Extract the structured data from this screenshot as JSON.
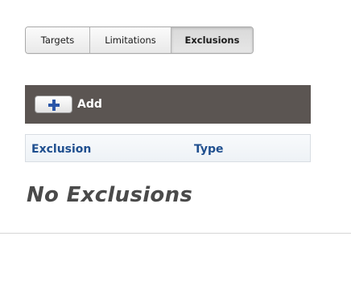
{
  "tabs": [
    {
      "label": "Targets",
      "active": false
    },
    {
      "label": "Limitations",
      "active": false
    },
    {
      "label": "Exclusions",
      "active": true
    }
  ],
  "toolbar": {
    "add_label": "Add",
    "add_icon": "plus-icon",
    "background_color": "#5b5552"
  },
  "table": {
    "columns": [
      "Exclusion",
      "Type"
    ],
    "header_color": "#1f4f8f"
  },
  "empty_message": "No Exclusions"
}
